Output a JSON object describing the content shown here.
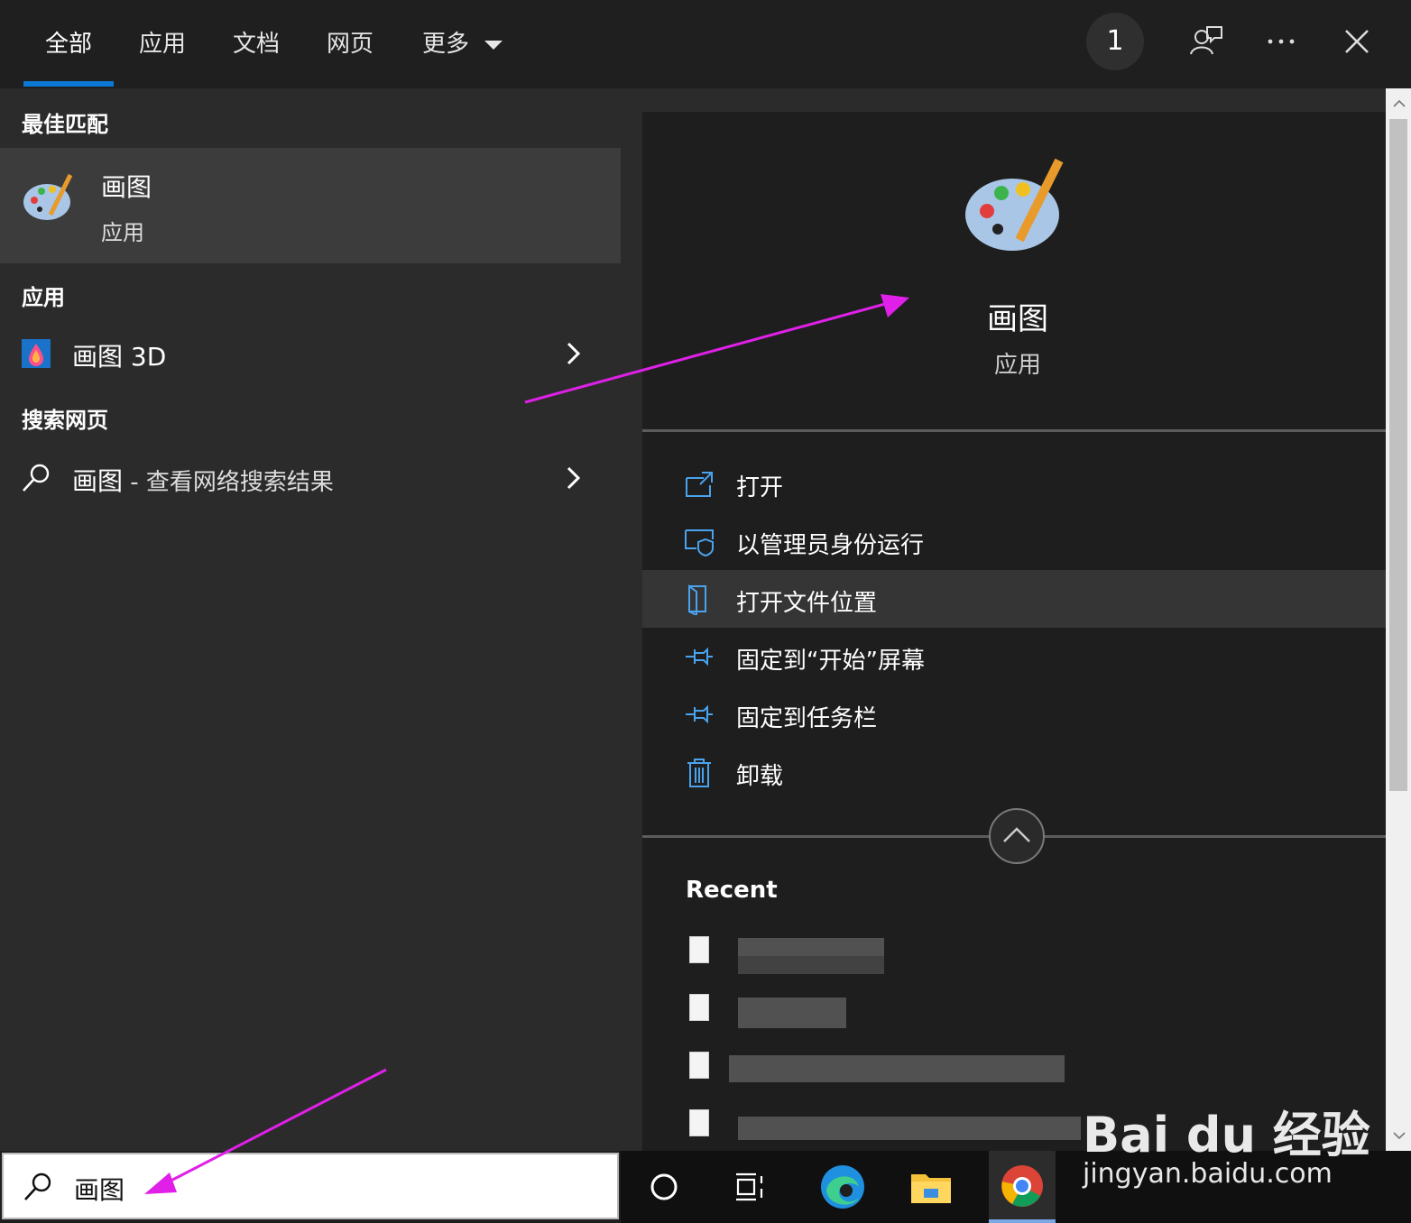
{
  "tabs": [
    {
      "label": "全部",
      "active": true
    },
    {
      "label": "应用"
    },
    {
      "label": "文档"
    },
    {
      "label": "网页"
    },
    {
      "label": "更多"
    }
  ],
  "top_actions": {
    "badge_count": "1"
  },
  "left": {
    "best_match_header": "最佳匹配",
    "best_match": {
      "name": "画图",
      "type": "应用"
    },
    "apps_header": "应用",
    "apps": [
      {
        "name": "画图 3D"
      }
    ],
    "web_header": "搜索网页",
    "web": {
      "query": "画图",
      "suffix": " - 查看网络搜索结果"
    }
  },
  "right": {
    "app_name": "画图",
    "app_type": "应用",
    "actions": [
      {
        "label": "打开",
        "icon": "open-icon"
      },
      {
        "label": "以管理员身份运行",
        "icon": "shield-run-icon"
      },
      {
        "label": "打开文件位置",
        "icon": "file-location-icon"
      },
      {
        "label": "固定到“开始”屏幕",
        "icon": "pin-icon"
      },
      {
        "label": "固定到任务栏",
        "icon": "pin-icon"
      },
      {
        "label": "卸载",
        "icon": "trash-icon"
      }
    ],
    "recent_header": "Recent"
  },
  "search": {
    "value": "画图"
  },
  "watermark": {
    "brand": "Bai du 经验",
    "url": "jingyan.baidu.com"
  },
  "colors": {
    "accent": "#0a78d4",
    "arrow": "#e020e8"
  }
}
